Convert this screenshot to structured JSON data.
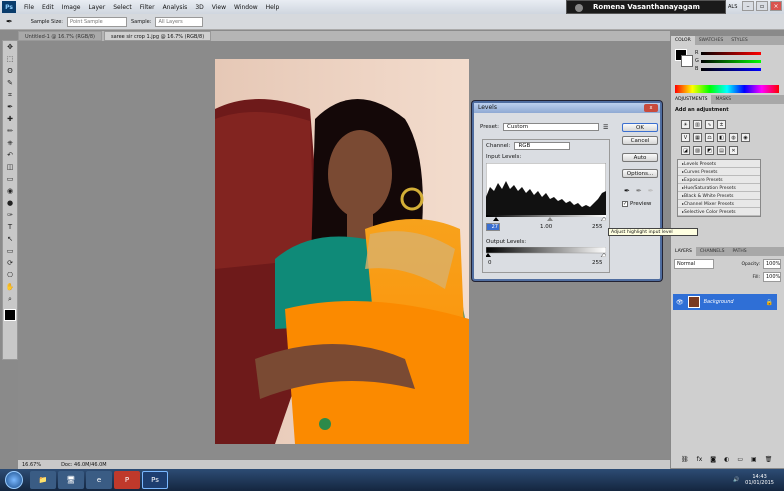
{
  "app": {
    "logo": "Ps"
  },
  "menu": [
    "File",
    "Edit",
    "Image",
    "Layer",
    "Select",
    "Filter",
    "Analysis",
    "3D",
    "View",
    "Window",
    "Help"
  ],
  "user": {
    "name": "Romena Vasanthanayagam"
  },
  "workspace": "ALS",
  "options_bar": {
    "sample_size_label": "Sample Size:",
    "sample_size_value": "Point Sample",
    "sample_label": "Sample:",
    "sample_value": "All Layers"
  },
  "doc_tabs": [
    {
      "label": "Untitled-1 @ 16.7% (RGB/8)",
      "active": false
    },
    {
      "label": "saree sir crop 1.jpg @ 16.7% (RGB/8)",
      "active": true
    }
  ],
  "status": {
    "zoom": "16.67%",
    "doc": "Doc: 46.0M/46.0M"
  },
  "levels": {
    "title": "Levels",
    "preset_label": "Preset:",
    "preset_value": "Custom",
    "channel_label": "Channel:",
    "channel_value": "RGB",
    "input_label": "Input Levels:",
    "input_black": "27",
    "input_mid": "1.00",
    "input_white": "255",
    "output_label": "Output Levels:",
    "output_black": "0",
    "output_white": "255",
    "ok": "OK",
    "cancel": "Cancel",
    "auto": "Auto",
    "options": "Options...",
    "preview_label": "Preview",
    "preview_checked": true,
    "close": "x"
  },
  "tooltip": "Adjust highlight input level",
  "panels": {
    "color_tabs": [
      "COLOR",
      "SWATCHES",
      "STYLES"
    ],
    "adj_tabs": [
      "ADJUSTMENTS",
      "MASKS"
    ],
    "add_adjustment": "Add an adjustment",
    "presets": [
      "Levels Presets",
      "Curves Presets",
      "Exposure Presets",
      "Hue/Saturation Presets",
      "Black & White Presets",
      "Channel Mixer Presets",
      "Selective Color Presets"
    ],
    "layer_tabs": [
      "LAYERS",
      "CHANNELS",
      "PATHS"
    ],
    "blend_mode": "Normal",
    "opacity_label": "Opacity:",
    "opacity": "100%",
    "fill_label": "Fill:",
    "fill": "100%",
    "layer_name": "Background"
  },
  "taskbar": {
    "time": "14:43",
    "date": "01/01/2015"
  },
  "colors": {
    "accent": "#2f6fd6",
    "dialog_border": "#4f6da0"
  }
}
